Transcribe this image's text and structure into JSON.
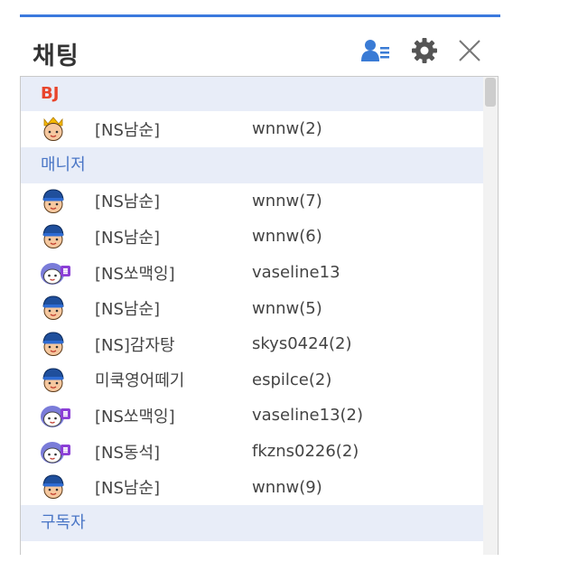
{
  "title": "채팅",
  "header_icons": {
    "user_list": "user-list-icon",
    "settings": "gear-icon",
    "close": "close-icon"
  },
  "colors": {
    "accent_line": "#3b79de",
    "bj_label": "#e8452c",
    "manager_label": "#4a76c6",
    "group_bg": "#e8edf8"
  },
  "groups": [
    {
      "label": "BJ",
      "users": [
        {
          "nick": "[NS남순]",
          "id": "wnnw(2)",
          "avatar": "crown-avatar-icon"
        }
      ]
    },
    {
      "label": "매니저",
      "users": [
        {
          "nick": "[NS남순]",
          "id": "wnnw(7)",
          "avatar": "manager-avatar-icon"
        },
        {
          "nick": "[NS남순]",
          "id": "wnnw(6)",
          "avatar": "manager-avatar-icon"
        },
        {
          "nick": "[NS쏘맥잉]",
          "id": "vaseline13",
          "avatar": "manager-subscriber-avatar-icon"
        },
        {
          "nick": "[NS남순]",
          "id": "wnnw(5)",
          "avatar": "manager-avatar-icon"
        },
        {
          "nick": "[NS]감자탕",
          "id": "skys0424(2)",
          "avatar": "manager-avatar-icon"
        },
        {
          "nick": "미쿡영어떼기",
          "id": "espilce(2)",
          "avatar": "manager-avatar-icon"
        },
        {
          "nick": "[NS쏘맥잉]",
          "id": "vaseline13(2)",
          "avatar": "manager-subscriber-avatar-icon"
        },
        {
          "nick": "[NS동석]",
          "id": "fkzns0226(2)",
          "avatar": "manager-subscriber-avatar-icon"
        },
        {
          "nick": "[NS남순]",
          "id": "wnnw(9)",
          "avatar": "manager-avatar-icon"
        }
      ]
    },
    {
      "label": "구독자",
      "users": []
    }
  ]
}
